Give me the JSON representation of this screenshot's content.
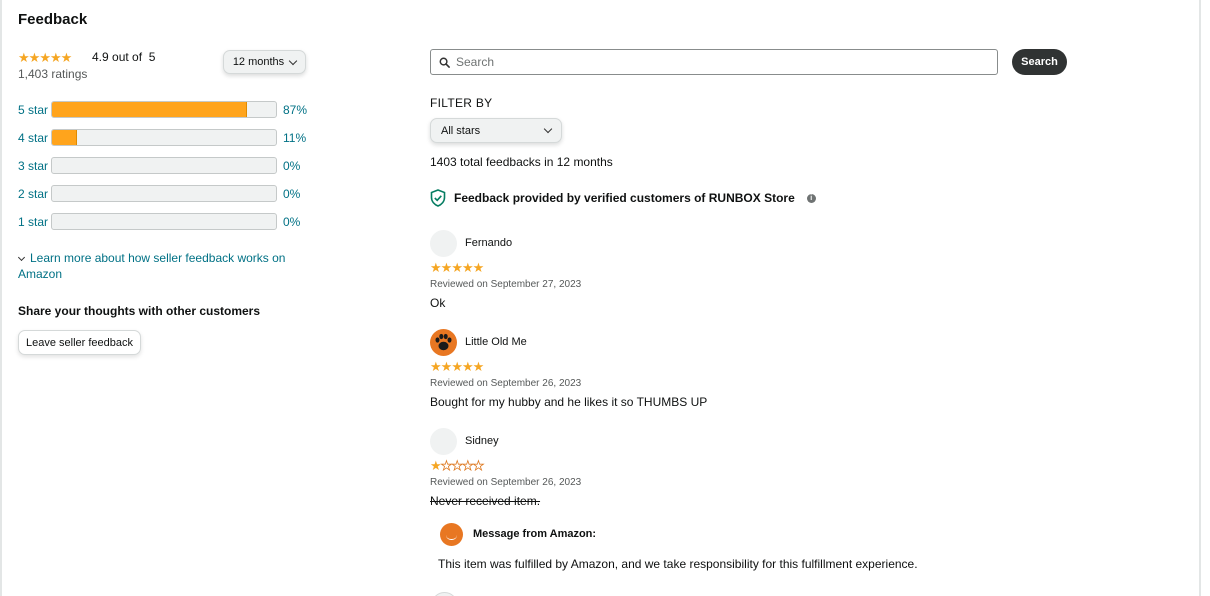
{
  "page": {
    "title": "Feedback"
  },
  "summary": {
    "rating_text": "4.9 out of",
    "rating_max": "5",
    "rating_value": 4.9,
    "ratings_count": "1,403 ratings",
    "period_button": "12 months"
  },
  "histogram": [
    {
      "label": "5 star",
      "percent_text": "87%",
      "percent": 87
    },
    {
      "label": "4 star",
      "percent_text": "11%",
      "percent": 11
    },
    {
      "label": "3 star",
      "percent_text": "0%",
      "percent": 0
    },
    {
      "label": "2 star",
      "percent_text": "0%",
      "percent": 0
    },
    {
      "label": "1 star",
      "percent_text": "0%",
      "percent": 0
    }
  ],
  "learn_more": "Learn more about how seller feedback works on Amazon",
  "share": {
    "heading": "Share your thoughts with other customers",
    "button": "Leave seller feedback"
  },
  "search": {
    "placeholder": "Search",
    "button": "Search"
  },
  "filter": {
    "label": "FILTER BY",
    "selected": "All stars",
    "total_text": "1403 total feedbacks in 12 months"
  },
  "verified_text": "Feedback provided by verified customers of RUNBOX Store",
  "reviews": [
    {
      "name": "Fernando",
      "stars": 5,
      "date": "Reviewed on September 27, 2023",
      "text": "Ok"
    },
    {
      "name": "Little Old Me",
      "stars": 5,
      "date": "Reviewed on September 26, 2023",
      "text": "Bought for my hubby and he likes it so THUMBS UP"
    },
    {
      "name": "Sidney",
      "stars": 1,
      "date": "Reviewed on September 26, 2023",
      "text": "Never received item."
    }
  ],
  "amazon_message": {
    "title": "Message from Amazon:",
    "body": "This item was fulfilled by Amazon, and we take responsibility for this fulfillment experience."
  },
  "colors": {
    "star": "#f5a623",
    "bar_fill": "#ffa41c",
    "link": "#007185",
    "search_button": "#303333",
    "amazon_orange": "#e87722"
  }
}
